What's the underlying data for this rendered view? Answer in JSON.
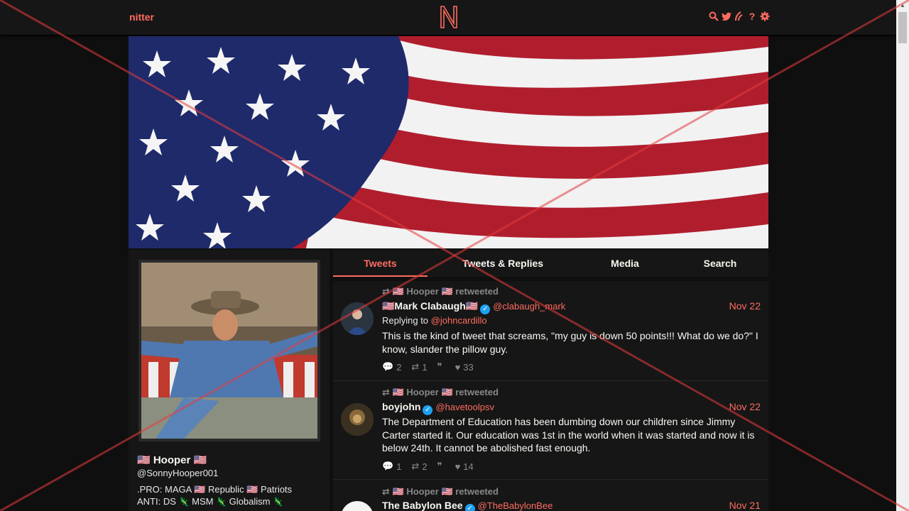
{
  "nav": {
    "brand": "nitter",
    "icons": [
      "search-icon",
      "twitter-icon",
      "rss-icon",
      "help-icon",
      "gear-icon"
    ]
  },
  "profile": {
    "fullname": "🇺🇸 Hooper 🇺🇸",
    "username": "@SonnyHooper001",
    "bio_line1": ".PRO:   MAGA 🇺🇸 Republic 🇺🇸 Patriots",
    "bio_line2_prefix": "ANTI:   DS",
    "bio_line2_a": "MSM",
    "bio_line2_b": "Globalism"
  },
  "tabs": [
    {
      "label": "Tweets",
      "active": true
    },
    {
      "label": "Tweets & Replies",
      "active": false
    },
    {
      "label": "Media",
      "active": false
    },
    {
      "label": "Search",
      "active": false
    }
  ],
  "tweets": [
    {
      "retweet_label": "🇺🇸 Hooper 🇺🇸 retweeted",
      "name": "🇺🇸Mark Clabaugh🇺🇸",
      "handle": "@clabaugh_mark",
      "date": "Nov 22",
      "replying_prefix": "Replying to",
      "replying_to": "@johncardillo",
      "text": "This is the kind of tweet that screams, \"my guy is down 50 points!!! What do we do?\" I know, slander the pillow guy.",
      "replies": "2",
      "retweets": "1",
      "quotes": "",
      "likes": "33"
    },
    {
      "retweet_label": "🇺🇸 Hooper 🇺🇸 retweeted",
      "name": "boyjohn",
      "handle": "@havetoolpsv",
      "date": "Nov 22",
      "text": "The Department of Education has been dumbing down our children since Jimmy Carter started it. Our education was 1st in the world when it was started and now it is below 24th. It cannot be abolished fast enough.",
      "replies": "1",
      "retweets": "2",
      "quotes": "",
      "likes": "14"
    },
    {
      "retweet_label": "🇺🇸 Hooper 🇺🇸 retweeted",
      "name": "The Babylon Bee",
      "handle": "@TheBabylonBee",
      "date": "Nov 21"
    }
  ],
  "colors": {
    "accent": "#ff6c60",
    "background": "#0f0f0f",
    "panel": "#161616",
    "verified": "#1da1f2"
  }
}
